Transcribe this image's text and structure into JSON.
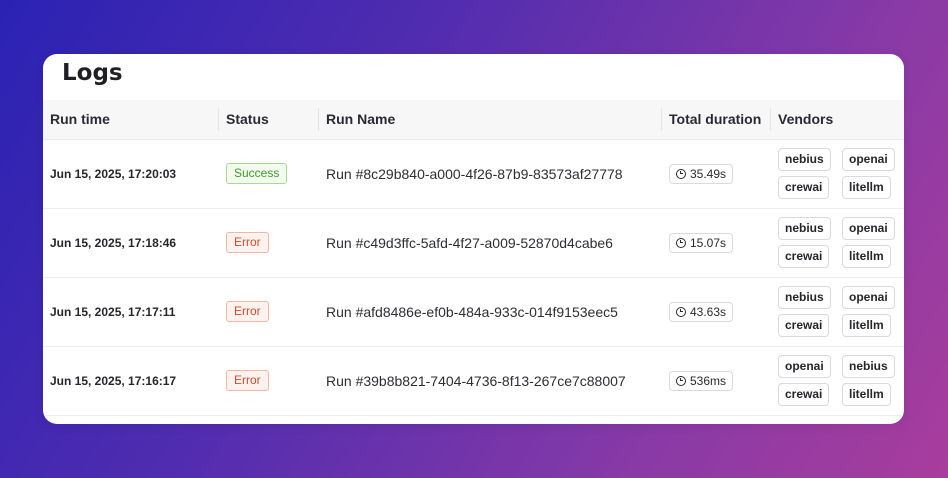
{
  "page": {
    "title": "Logs"
  },
  "table": {
    "columns": [
      "Run time",
      "Status",
      "Run Name",
      "Total duration",
      "Vendors"
    ],
    "rows": [
      {
        "run_time": "Jun 15, 2025, 17:20:03",
        "status": "Success",
        "status_type": "success",
        "run_name": "Run #8c29b840-a000-4f26-87b9-83573af27778",
        "duration": "35.49s",
        "vendors": [
          "nebius",
          "openai",
          "crewai",
          "litellm"
        ]
      },
      {
        "run_time": "Jun 15, 2025, 17:18:46",
        "status": "Error",
        "status_type": "error",
        "run_name": "Run #c49d3ffc-5afd-4f27-a009-52870d4cabe6",
        "duration": "15.07s",
        "vendors": [
          "nebius",
          "openai",
          "crewai",
          "litellm"
        ]
      },
      {
        "run_time": "Jun 15, 2025, 17:17:11",
        "status": "Error",
        "status_type": "error",
        "run_name": "Run #afd8486e-ef0b-484a-933c-014f9153eec5",
        "duration": "43.63s",
        "vendors": [
          "nebius",
          "openai",
          "crewai",
          "litellm"
        ]
      },
      {
        "run_time": "Jun 15, 2025, 17:16:17",
        "status": "Error",
        "status_type": "error",
        "run_name": "Run #39b8b821-7404-4736-8f13-267ce7c88007",
        "duration": "536ms",
        "vendors": [
          "openai",
          "nebius",
          "crewai",
          "litellm"
        ]
      }
    ]
  },
  "colors": {
    "success": "#3d9a2b",
    "error": "#d44a2a",
    "header_bg": "#f7f7f8"
  }
}
